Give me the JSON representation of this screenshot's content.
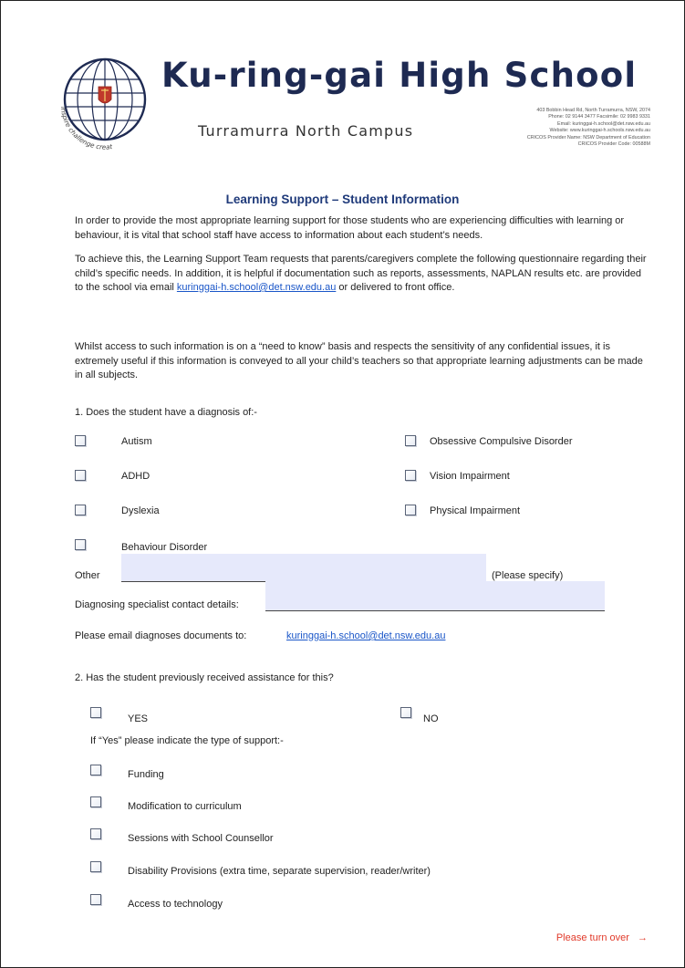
{
  "header": {
    "school_name": "Ku-ring-gai High School",
    "campus": "Turramurra North Campus",
    "logo_motto": "inspire challenge create",
    "address_lines": [
      "403 Bobbin Head Rd, North Turramurra, NSW, 2074",
      "Phone: 02 9144 3477  Facsimile: 02 9983 9331",
      "Email: kuringgai-h.school@det.nsw.edu.au",
      "Website: www.kuringgai-h.schools.nsw.edu.au",
      "CRICOS Provider Name: NSW Department of Education",
      "CRICOS Provider Code: 00588M"
    ]
  },
  "title": "Learning Support – Student Information",
  "paragraphs": {
    "p1": "In order to provide the most appropriate learning support for those students who are experiencing difficulties with learning or behaviour, it is vital that school staff have access to information about each student’s needs.",
    "p2_before": "To achieve this, the Learning Support Team requests that parents/caregivers complete the following questionnaire regarding their child’s specific needs. In addition, it is helpful if documentation such as reports, assessments, NAPLAN results etc. are provided to the school via email ",
    "p2_email": "kuringgai-h.school@det.nsw.edu.au",
    "p2_after": " or delivered to front office.",
    "p3": "Whilst access to such information is on a “need to know” basis and respects the sensitivity of any confidential issues, it is extremely useful if this information is conveyed to all your child’s teachers so that appropriate learning adjustments can be made in all subjects."
  },
  "q1": {
    "label": "1.   Does the student have a diagnosis of:-",
    "left_options": [
      "Autism",
      "ADHD",
      "Dyslexia",
      "Behaviour Disorder"
    ],
    "right_options": [
      "Obsessive Compulsive Disorder",
      "Vision Impairment",
      "Physical Impairment"
    ],
    "other_label": "Other",
    "please_specify": "(Please specify)",
    "specialist_label": "Diagnosing specialist contact details:",
    "email_label": "Please email diagnoses documents to:",
    "email": "kuringgai-h.school@det.nsw.edu.au"
  },
  "q2": {
    "label": "2.   Has the student previously received assistance for this?",
    "yes": "YES",
    "no": "NO",
    "if_yes": "If “Yes” please indicate the type of support:-",
    "support_options": [
      "Funding",
      "Modification to curriculum",
      "Sessions with School Counsellor",
      "Disability Provisions (extra time, separate supervision, reader/writer)",
      "Access to technology"
    ]
  },
  "footer": {
    "turn_over": "Please turn over",
    "arrow": "→"
  },
  "colors": {
    "navy": "#1e2a52",
    "title_blue": "#1f3a7a",
    "link": "#1a56c8",
    "accent_red": "#e13a2a",
    "field_fill": "#e6e9fb"
  }
}
